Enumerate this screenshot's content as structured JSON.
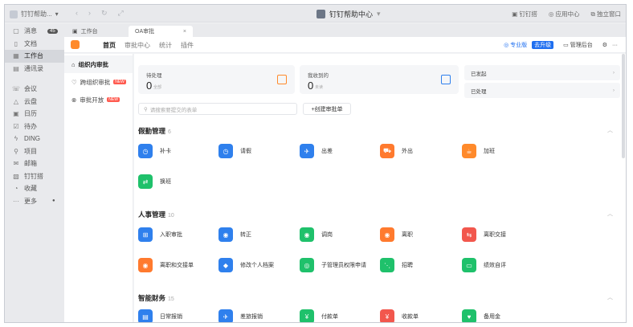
{
  "titlebar": {
    "left_label": "钉钉帮助...",
    "center_title": "钉钉帮助中心",
    "right_items": [
      "钉钉搭",
      "应用中心",
      "独立窗口"
    ]
  },
  "leftnav": {
    "items": [
      {
        "label": "消息",
        "icon": "message-icon",
        "badge": "45"
      },
      {
        "label": "文档",
        "icon": "doc-icon"
      },
      {
        "label": "工作台",
        "icon": "grid-icon",
        "active": true
      },
      {
        "label": "通讯录",
        "icon": "contacts-icon"
      },
      {
        "label": "会议",
        "icon": "meeting-icon"
      },
      {
        "label": "云盘",
        "icon": "cloud-icon"
      },
      {
        "label": "日历",
        "icon": "calendar-icon"
      },
      {
        "label": "待办",
        "icon": "todo-icon"
      },
      {
        "label": "DING",
        "icon": "ding-icon"
      },
      {
        "label": "项目",
        "icon": "project-icon"
      },
      {
        "label": "邮箱",
        "icon": "mail-icon"
      },
      {
        "label": "钉钉搭",
        "icon": "builder-icon"
      },
      {
        "label": "收藏",
        "icon": "favorite-icon"
      },
      {
        "label": "更多",
        "icon": "more-icon"
      }
    ]
  },
  "tabs": [
    {
      "label": "工作台"
    },
    {
      "label": "OA审批"
    }
  ],
  "toolbar": {
    "menu": [
      "首页",
      "审批中心",
      "统计",
      "插件"
    ],
    "pro_label": "专业版",
    "upgrade_label": "去升级",
    "admin_label": "管理后台",
    "more": "···"
  },
  "subside": {
    "items": [
      {
        "label": "组织内审批",
        "active": true
      },
      {
        "label": "跨组织审批",
        "tag": "NEW"
      },
      {
        "label": "审批开放",
        "tag": "NEW"
      }
    ]
  },
  "cards": {
    "pending": {
      "label": "待处理",
      "count": "0",
      "sub": "全部"
    },
    "received": {
      "label": "我收到的",
      "count": "0",
      "sub": "未读"
    },
    "sent": {
      "label": "已发起"
    },
    "done": {
      "label": "已处理"
    }
  },
  "search": {
    "placeholder": "请搜索要提交的表单"
  },
  "create_label": "+创建审批单",
  "sections": [
    {
      "title": "假勤管理",
      "count": "6",
      "apps": [
        {
          "name": "补卡",
          "color": "#2f80ed",
          "glyph": "◷"
        },
        {
          "name": "请假",
          "color": "#2f80ed",
          "glyph": "◷"
        },
        {
          "name": "出差",
          "color": "#2f80ed",
          "glyph": "✈"
        },
        {
          "name": "外出",
          "color": "#ff7a2e",
          "glyph": "⛟"
        },
        {
          "name": "加班",
          "color": "#ff8a2b",
          "glyph": "☕"
        },
        {
          "name": "换班",
          "color": "#1fc16b",
          "glyph": "⇄"
        }
      ]
    },
    {
      "title": "人事管理",
      "count": "10",
      "apps": [
        {
          "name": "入职审批",
          "color": "#2f80ed",
          "glyph": "⊞"
        },
        {
          "name": "转正",
          "color": "#2f80ed",
          "glyph": "◉"
        },
        {
          "name": "调岗",
          "color": "#1fc16b",
          "glyph": "◉"
        },
        {
          "name": "离职",
          "color": "#ff7a2e",
          "glyph": "◉"
        },
        {
          "name": "离职交接",
          "color": "#f2574d",
          "glyph": "⇆"
        },
        {
          "name": "离职和交接单",
          "color": "#ff7a2e",
          "glyph": "◉"
        },
        {
          "name": "修改个人档案",
          "color": "#2f80ed",
          "glyph": "◆"
        },
        {
          "name": "子管理员权限申请",
          "color": "#1fc16b",
          "glyph": "◎"
        },
        {
          "name": "招聘",
          "color": "#1fc16b",
          "glyph": "⋱"
        },
        {
          "name": "绩效自评",
          "color": "#1fc16b",
          "glyph": "▭"
        }
      ]
    },
    {
      "title": "智能财务",
      "count": "15",
      "apps": [
        {
          "name": "日常报销",
          "color": "#2f80ed",
          "glyph": "▤"
        },
        {
          "name": "差旅报销",
          "color": "#2f80ed",
          "glyph": "✈"
        },
        {
          "name": "付款单",
          "color": "#1fc16b",
          "glyph": "¥"
        },
        {
          "name": "收款单",
          "color": "#f2574d",
          "glyph": "¥"
        },
        {
          "name": "备用金",
          "color": "#1fc16b",
          "glyph": "♥"
        }
      ]
    }
  ]
}
